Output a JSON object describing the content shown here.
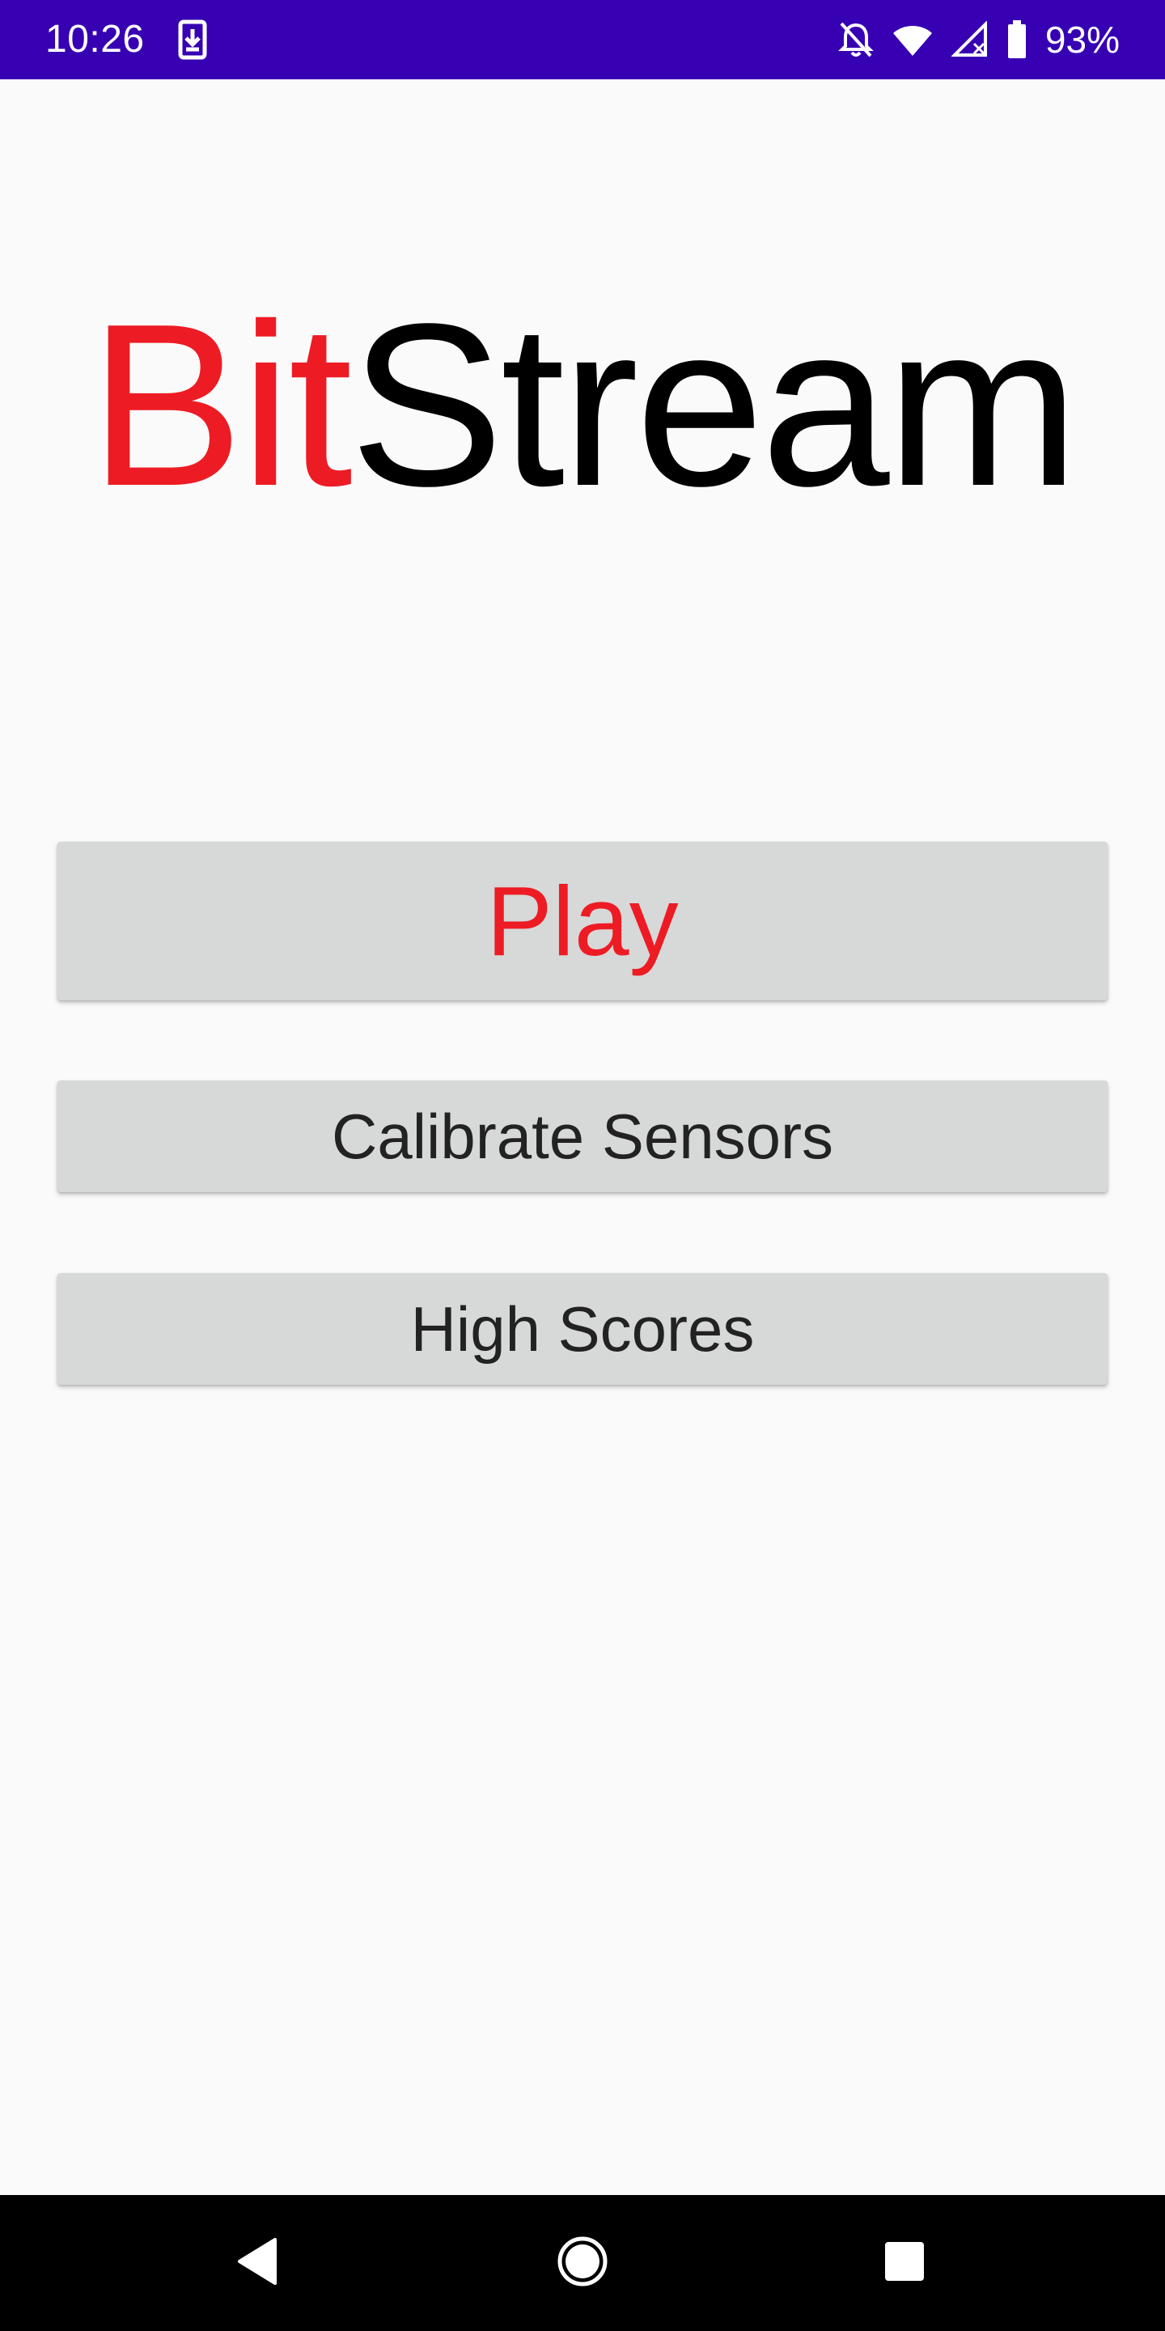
{
  "status_bar": {
    "time": "10:26",
    "battery_percent": "93%",
    "icons": [
      "download-notification-icon",
      "notifications-off-icon",
      "wifi-icon",
      "cell-signal-icon",
      "battery-icon"
    ],
    "background_color": "#3700b3"
  },
  "title": {
    "part1": "Bit",
    "part2": "Stream",
    "part1_color": "#ed1c24",
    "part2_color": "#000000"
  },
  "menu": {
    "play_label": "Play",
    "calibrate_label": "Calibrate Sensors",
    "high_scores_label": "High Scores",
    "button_color": "#d7d8d8",
    "play_text_color": "#ed1c24"
  },
  "nav_bar": {
    "icons": [
      "back-icon",
      "home-icon",
      "recents-icon"
    ]
  }
}
